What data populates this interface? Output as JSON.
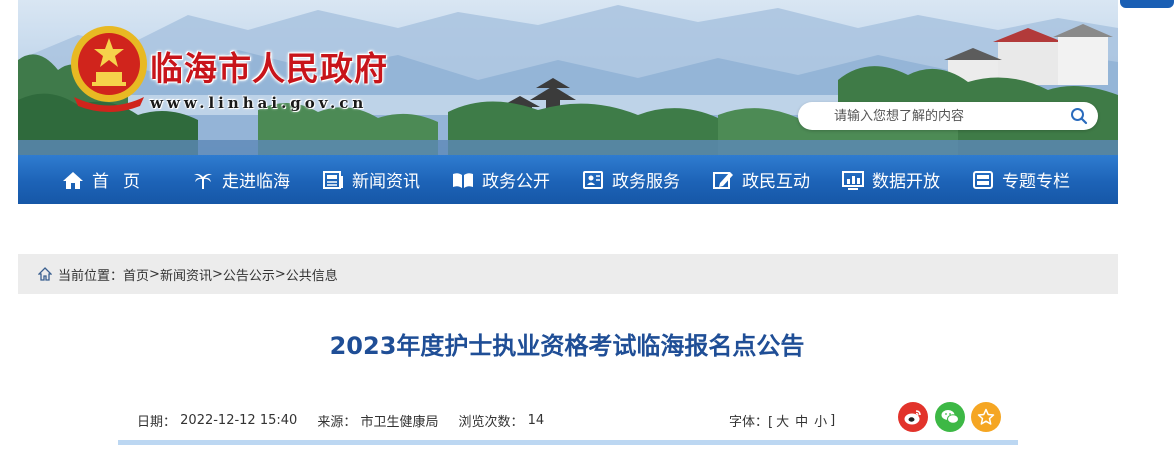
{
  "site": {
    "title": "临海市人民政府",
    "url": "www.linhai.gov.cn"
  },
  "search": {
    "placeholder": "请输入您想了解的内容"
  },
  "nav": {
    "items": [
      {
        "label": "首页",
        "icon": "home-icon"
      },
      {
        "label": "走进临海",
        "icon": "palm-tree-icon"
      },
      {
        "label": "新闻资讯",
        "icon": "newspaper-icon"
      },
      {
        "label": "政务公开",
        "icon": "open-book-icon"
      },
      {
        "label": "政务服务",
        "icon": "service-icon"
      },
      {
        "label": "政民互动",
        "icon": "edit-icon"
      },
      {
        "label": "数据开放",
        "icon": "bar-chart-icon"
      },
      {
        "label": "专题专栏",
        "icon": "column-icon"
      }
    ]
  },
  "breadcrumb": {
    "prefix": "当前位置：",
    "items": [
      "首页",
      "新闻资讯",
      "公告公示",
      "公共信息"
    ],
    "separator": ">"
  },
  "article": {
    "title": "2023年度护士执业资格考试临海报名点公告",
    "date_label": "日期：",
    "date": "2022-12-12 15:40",
    "source_label": "来源：",
    "source": "市卫生健康局",
    "views_label": "浏览次数：",
    "views": "14",
    "font_label": "字体：[",
    "font_large": "大",
    "font_medium": "中",
    "font_small": "小",
    "font_close": "]"
  },
  "share": [
    {
      "name": "weibo-icon",
      "color": "#e2332b"
    },
    {
      "name": "wechat-icon",
      "color": "#3db845"
    },
    {
      "name": "favorite-icon",
      "color": "#f5a623"
    }
  ],
  "colors": {
    "nav_bg": "#1d63b7",
    "title_blue": "#1f4e96",
    "site_title_red": "#c8141a",
    "breadcrumb_bg": "#ececec"
  }
}
